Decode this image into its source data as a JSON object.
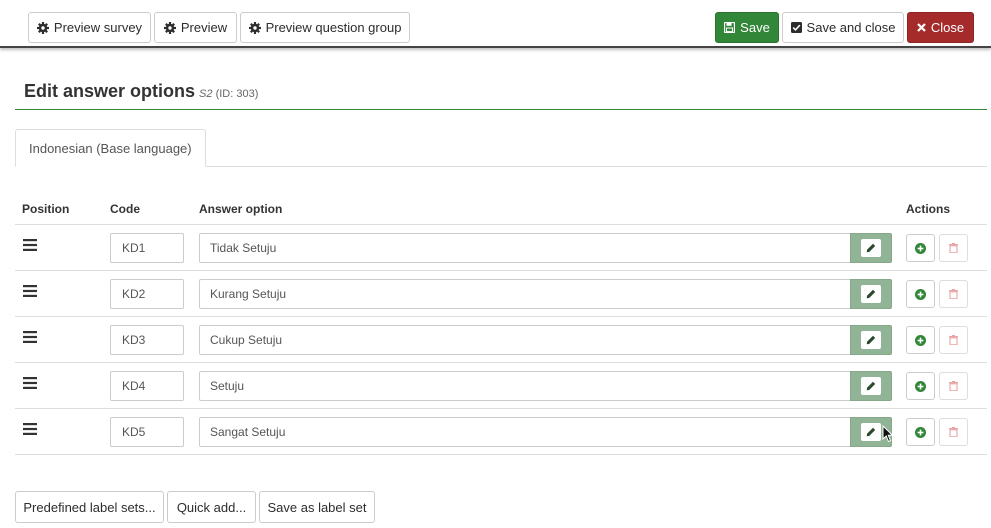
{
  "toolbar": {
    "preview_survey": "Preview survey",
    "preview": "Preview",
    "preview_question_group": "Preview question group",
    "save": "Save",
    "save_and_close": "Save and close",
    "close": "Close"
  },
  "heading": {
    "title": "Edit answer options",
    "question_code": "S2",
    "question_id": "(ID: 303)"
  },
  "tabs": [
    {
      "label": "Indonesian (Base language)",
      "active": true
    }
  ],
  "table": {
    "headers": {
      "position": "Position",
      "code": "Code",
      "answer": "Answer option",
      "actions": "Actions"
    },
    "rows": [
      {
        "code": "KD1",
        "answer": "Tidak Setuju"
      },
      {
        "code": "KD2",
        "answer": "Kurang Setuju"
      },
      {
        "code": "KD3",
        "answer": "Cukup Setuju"
      },
      {
        "code": "KD4",
        "answer": "Setuju"
      },
      {
        "code": "KD5",
        "answer": "Sangat Setuju"
      }
    ]
  },
  "bottom": {
    "predefined": "Predefined label sets...",
    "quick_add": "Quick add...",
    "save_label_set": "Save as label set"
  },
  "icons": {
    "gear": "gear-icon",
    "save": "floppy-icon",
    "check": "check-square-icon",
    "close": "x-icon",
    "drag": "bars-icon",
    "edit": "pencil-icon",
    "add": "plus-circle-icon",
    "delete": "trash-icon"
  },
  "colors": {
    "success": "#328637",
    "danger": "#a52b2b",
    "edit_addon": "#92b496",
    "delete_icon": "#e8a4a4"
  }
}
